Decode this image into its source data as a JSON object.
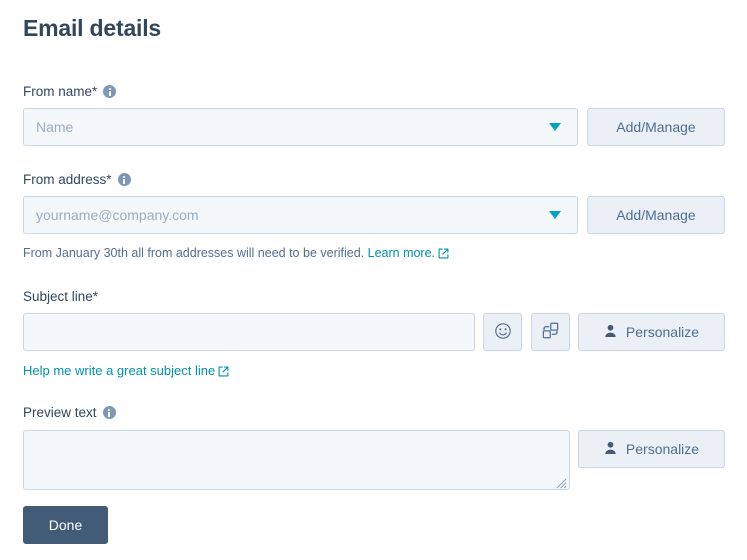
{
  "page": {
    "title": "Email details"
  },
  "fields": {
    "from_name": {
      "label": "From name",
      "required_marker": "*",
      "placeholder": "Name",
      "value": "",
      "action_button": "Add/Manage",
      "info_tooltip_name": "info-icon"
    },
    "from_address": {
      "label": "From address",
      "required_marker": "*",
      "placeholder": "yourname@company.com",
      "value": "",
      "action_button": "Add/Manage",
      "helper_text": "From January 30th all from addresses will need to be verified.",
      "helper_link": "Learn more."
    },
    "subject_line": {
      "label": "Subject line",
      "required_marker": "*",
      "placeholder": "",
      "value": "",
      "emoji_button_name": "emoji-icon",
      "ab_test_button_name": "ab-variation-icon",
      "personalize_button": "Personalize",
      "helper_link": "Help me write a great subject line"
    },
    "preview_text": {
      "label": "Preview text",
      "placeholder": "",
      "value": "",
      "personalize_button": "Personalize"
    }
  },
  "footer": {
    "done_button": "Done"
  },
  "colors": {
    "title": "#33475b",
    "label": "#33475b",
    "input_bg": "#f5f8fa",
    "input_border": "#cbd6e2",
    "placeholder": "#99acc2",
    "caret_teal": "#00a4bd",
    "link": "#0091ae",
    "button_secondary_bg": "#eaf0f6",
    "button_secondary_text": "#506e91",
    "button_primary_bg": "#425b76",
    "info_icon": "#7c98b6"
  }
}
